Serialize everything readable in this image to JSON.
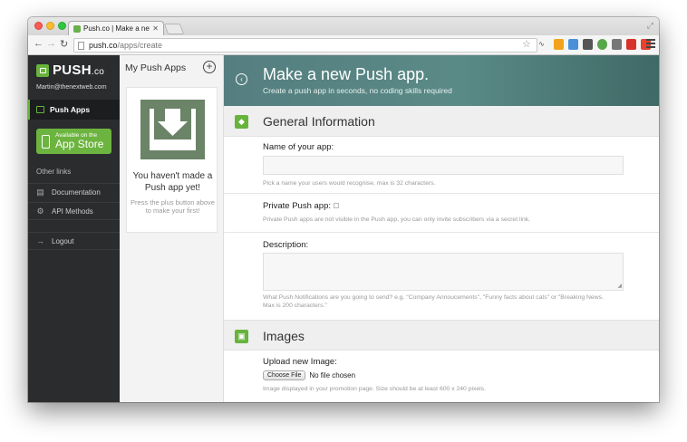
{
  "browser": {
    "tab_title": "Push.co | Make a new Push",
    "tab_close": "✕",
    "url_host": "push.co",
    "url_path": "/apps/create"
  },
  "sidebar": {
    "logo_main": "PUSH",
    "logo_suffix": ".co",
    "email": "Martin@thenextweb.com",
    "active_item": "Push Apps",
    "app_store_small": "Available on the",
    "app_store_big": "App Store",
    "other_links_label": "Other links",
    "links": [
      {
        "label": "Documentation",
        "icon": "book-icon"
      },
      {
        "label": "API Methods",
        "icon": "gear-icon"
      },
      {
        "label": "Logout",
        "icon": "logout-arrow-icon"
      }
    ]
  },
  "middle": {
    "title": "My Push Apps",
    "plus": "+",
    "empty_title": "You haven't made a Push app yet!",
    "empty_sub": "Press the plus button above to make your first!"
  },
  "content": {
    "title": "Make a new Push app.",
    "subtitle": "Create a push app in seconds, no coding skills required",
    "general_section": "General Information",
    "name_label": "Name of your app:",
    "name_help": "Pick a name your users would recognise, max is 32 characters.",
    "private_label": "Private Push app:",
    "private_help": "Private Push apps are not visible in the Push app, you can only invite subscribers via a secret link.",
    "description_label": "Description:",
    "description_help": "What Push Notifications are you going to send? e.g. \"Company Annoucements\", \"Funny facts about cats\" or \"Breaking News. Max is 200 characters.\"",
    "images_section": "Images",
    "upload_label": "Upload new Image:",
    "choose_file": "Choose File",
    "no_file": "No file chosen",
    "image_help": "Image displayed in your promotion page. Size should be at least 600 x 240 pixels."
  },
  "colors": {
    "accent_green": "#68b33c",
    "sidebar_bg": "#2b2c2e",
    "hero_teal": "#5a8a86"
  }
}
